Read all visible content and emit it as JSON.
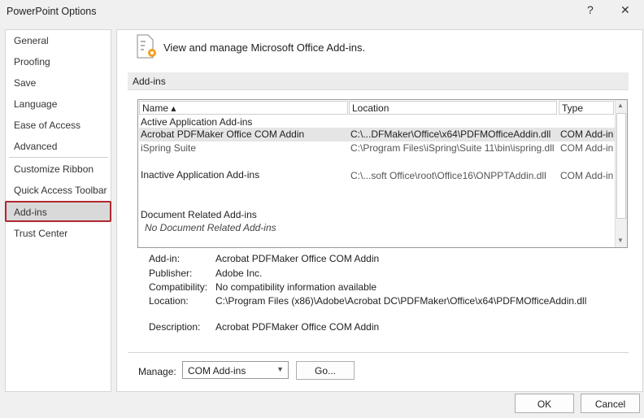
{
  "window": {
    "title": "PowerPoint Options",
    "help": "?",
    "close": "✕"
  },
  "sidebar": {
    "items": [
      "General",
      "Proofing",
      "Save",
      "Language",
      "Ease of Access",
      "Advanced",
      "Customize Ribbon",
      "Quick Access Toolbar",
      "Add-ins",
      "Trust Center"
    ],
    "selected": "Add-ins"
  },
  "main": {
    "heading": "View and manage Microsoft Office Add-ins.",
    "section": "Add-ins",
    "columns": {
      "name": "Name ▴",
      "location": "Location",
      "type": "Type"
    },
    "groups": {
      "active": "Active Application Add-ins",
      "inactive": "Inactive Application Add-ins",
      "document": "Document Related Add-ins",
      "document_empty": "No Document Related Add-ins"
    },
    "rows": [
      {
        "name": "Acrobat PDFMaker Office COM Addin",
        "location": "C:\\...DFMaker\\Office\\x64\\PDFMOfficeAddin.dll",
        "type": "COM Add-in"
      },
      {
        "name": "iSpring Suite",
        "location": "C:\\Program Files\\iSpring\\Suite 11\\bin\\ispring.dll",
        "type": "COM Add-in"
      },
      {
        "name": "",
        "location": "C:\\...soft Office\\root\\Office16\\ONPPTAddin.dll",
        "type": "COM Add-in"
      }
    ],
    "details": {
      "addin_label": "Add-in:",
      "addin": "Acrobat PDFMaker Office COM Addin",
      "publisher_label": "Publisher:",
      "publisher": "Adobe Inc.",
      "compat_label": "Compatibility:",
      "compat": "No compatibility information available",
      "location_label": "Location:",
      "location": "C:\\Program Files (x86)\\Adobe\\Acrobat DC\\PDFMaker\\Office\\x64\\PDFMOfficeAddin.dll",
      "desc_label": "Description:",
      "desc": "Acrobat PDFMaker Office COM Addin"
    },
    "manage_label": "Manage:",
    "manage_value": "COM Add-ins",
    "go": "Go..."
  },
  "footer": {
    "ok": "OK",
    "cancel": "Cancel"
  }
}
